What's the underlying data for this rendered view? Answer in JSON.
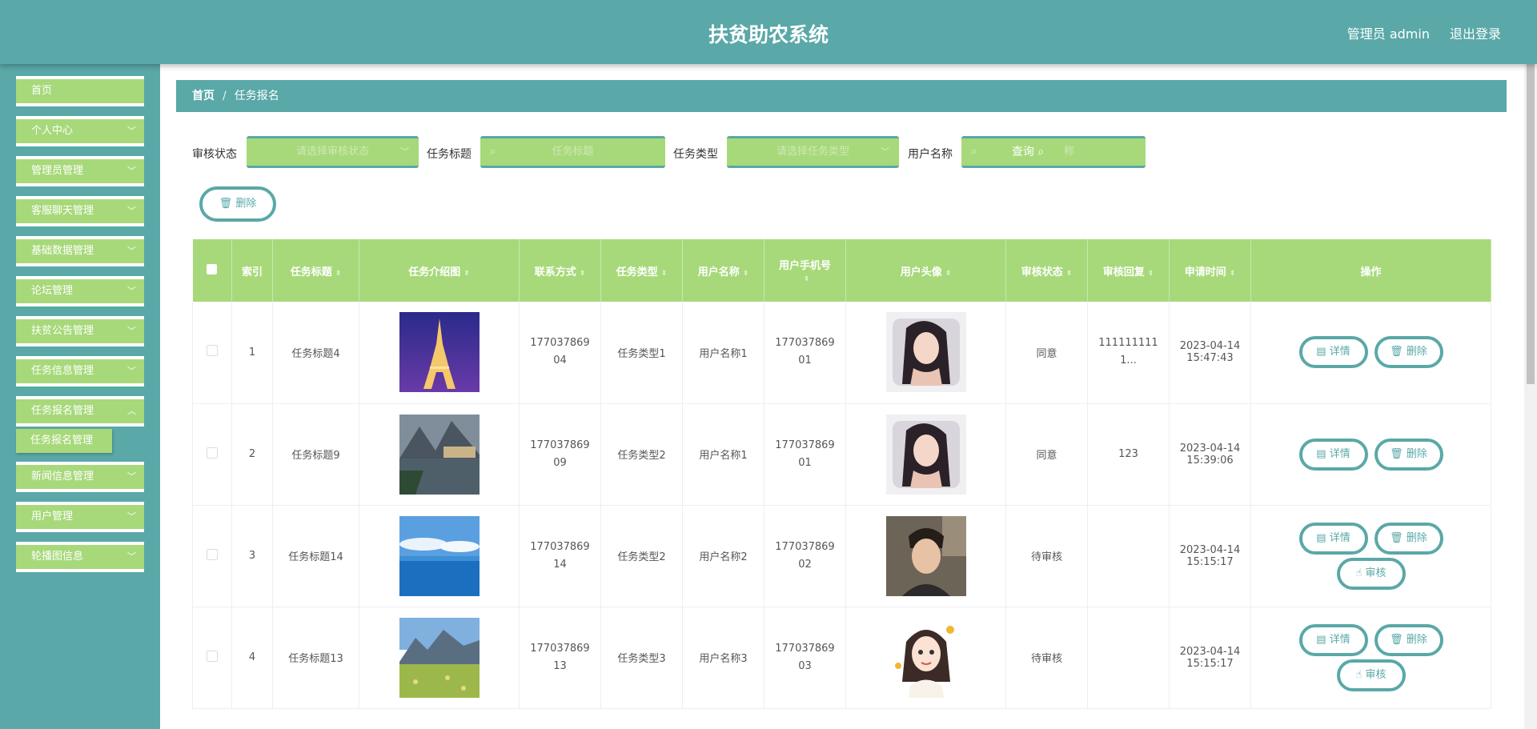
{
  "header": {
    "title": "扶贫助农系统",
    "admin": "管理员 admin",
    "logout": "退出登录"
  },
  "sidebar": {
    "items": [
      {
        "label": "首页"
      },
      {
        "label": "个人中心"
      },
      {
        "label": "管理员管理"
      },
      {
        "label": "客服聊天管理"
      },
      {
        "label": "基础数据管理"
      },
      {
        "label": "论坛管理"
      },
      {
        "label": "扶贫公告管理"
      },
      {
        "label": "任务信息管理"
      },
      {
        "label": "任务报名管理"
      },
      {
        "label": "新闻信息管理"
      },
      {
        "label": "用户管理"
      },
      {
        "label": "轮播图信息"
      }
    ],
    "submenu": "任务报名管理"
  },
  "breadcrumb": {
    "home": "首页",
    "sep": "/",
    "current": "任务报名"
  },
  "filters": {
    "status_label": "审核状态",
    "status_placeholder": "请选择审核状态",
    "title_label": "任务标题",
    "title_placeholder": "任务标题",
    "type_label": "任务类型",
    "type_placeholder": "请选择任务类型",
    "user_label": "用户名称",
    "user_placeholder": "用户名称",
    "query": "查询"
  },
  "toolbar": {
    "delete": "删除"
  },
  "table": {
    "headers": [
      "索引",
      "任务标题",
      "任务介绍图",
      "联系方式",
      "任务类型",
      "用户名称",
      "用户手机号",
      "用户头像",
      "审核状态",
      "审核回复",
      "申请时间",
      "操作"
    ],
    "rows": [
      {
        "index": "1",
        "title": "任务标题4",
        "phone": "17703786904",
        "type": "任务类型1",
        "user": "用户名称1",
        "user_phone": "17703786901",
        "status": "同意",
        "reply": "1111111111...",
        "date": "2023-04-14",
        "time": "15:47:43",
        "img": "eiffel-tower-night",
        "avatar": "woman-portrait-pillow",
        "audit": false
      },
      {
        "index": "2",
        "title": "任务标题9",
        "phone": "17703786909",
        "type": "任务类型2",
        "user": "用户名称1",
        "user_phone": "17703786901",
        "status": "同意",
        "reply": "123",
        "date": "2023-04-14",
        "time": "15:39:06",
        "img": "lake-village-mountains",
        "avatar": "woman-portrait-pillow",
        "audit": false
      },
      {
        "index": "3",
        "title": "任务标题14",
        "phone": "17703786914",
        "type": "任务类型2",
        "user": "用户名称2",
        "user_phone": "17703786902",
        "status": "待审核",
        "reply": "",
        "date": "2023-04-14",
        "time": "15:15:17",
        "img": "ocean-blue-sky",
        "avatar": "young-man-portrait",
        "audit": true
      },
      {
        "index": "4",
        "title": "任务标题13",
        "phone": "17703786913",
        "type": "任务类型3",
        "user": "用户名称3",
        "user_phone": "17703786903",
        "status": "待审核",
        "reply": "",
        "date": "2023-04-14",
        "time": "15:15:17",
        "img": "mountain-meadow",
        "avatar": "cartoon-girl",
        "audit": true
      }
    ],
    "actions": {
      "detail": "详情",
      "delete": "删除",
      "audit": "审核"
    }
  },
  "colors": {
    "teal": "#5aa8a8",
    "green": "#a7d97a"
  }
}
